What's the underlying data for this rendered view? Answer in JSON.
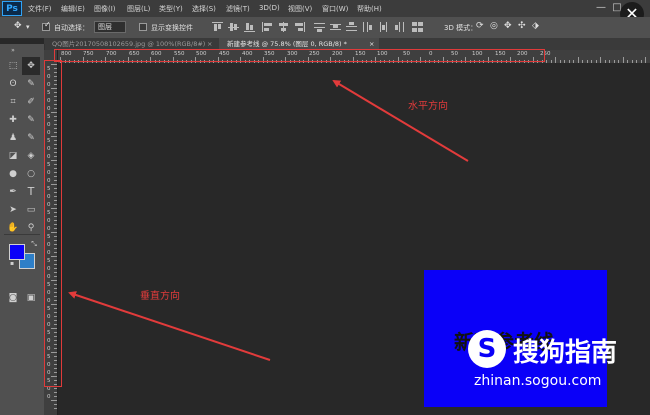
{
  "app": {
    "logo": "Ps"
  },
  "menubar": {
    "items": [
      "文件(F)",
      "编辑(E)",
      "图像(I)",
      "图层(L)",
      "类型(Y)",
      "选择(S)",
      "滤镜(T)",
      "3D(D)",
      "视图(V)",
      "窗口(W)",
      "帮助(H)"
    ]
  },
  "window": {
    "min": "—",
    "max": "□",
    "close": "✕"
  },
  "options": {
    "auto_select_label": "自动选择：",
    "auto_select_value": "图层",
    "show_transform_label": "显示变换控件",
    "mode_3d_label": "3D 模式："
  },
  "tabs": [
    {
      "label": "QQ图片20170508102659.jpg @ 100%(RGB/8#)",
      "close": "×",
      "active": false
    },
    {
      "label": "新建参考线 @ 75.8% (图层 0, RGB/8) *",
      "close": "×",
      "active": true
    }
  ],
  "ruler": {
    "h_labels": [
      "800",
      "750",
      "700",
      "650",
      "600",
      "550",
      "500",
      "450",
      "400",
      "350",
      "300",
      "250",
      "200",
      "150",
      "100",
      "50",
      "0",
      "50",
      "100",
      "150",
      "200",
      "250"
    ],
    "v_labels": [
      "5",
      "0",
      "0",
      "5",
      "0",
      "0",
      "5",
      "0",
      "0",
      "5",
      "0",
      "0",
      "5",
      "0",
      "0",
      "5",
      "0",
      "0",
      "5",
      "0",
      "0",
      "5",
      "0",
      "0",
      "5",
      "0",
      "0",
      "5",
      "0",
      "0",
      "5",
      "0",
      "0",
      "5",
      "0",
      "0",
      "5",
      "0",
      "0",
      "5",
      "0",
      "0"
    ]
  },
  "annotations": {
    "horizontal": "水平方向",
    "vertical": "垂直方向",
    "color": "#e23b3b"
  },
  "document": {
    "text": "新建参考线",
    "fill_color": "#0a00f8"
  },
  "watermark": {
    "logo": "S",
    "name": "搜狗指南",
    "url": "zhinan.sogou.com"
  },
  "colors": {
    "foreground": "#0a00f8",
    "background": "#2e7fc8"
  },
  "tools": {
    "move": "✥",
    "marquee": "⬚",
    "lasso": "ʘ",
    "quick_select": "✎",
    "crop": "⌗",
    "eyedropper": "✐",
    "heal": "✚",
    "brush": "✎",
    "stamp": "♟",
    "history": "✎",
    "eraser": "◪",
    "bucket": "◈",
    "blur": "●",
    "dodge": "○",
    "pen": "✒",
    "type": "T",
    "path_select": "➤",
    "shape": "▭",
    "hand": "✋",
    "zoom": "⚲",
    "quick_mask": "◙",
    "screen_mode": "▣"
  }
}
